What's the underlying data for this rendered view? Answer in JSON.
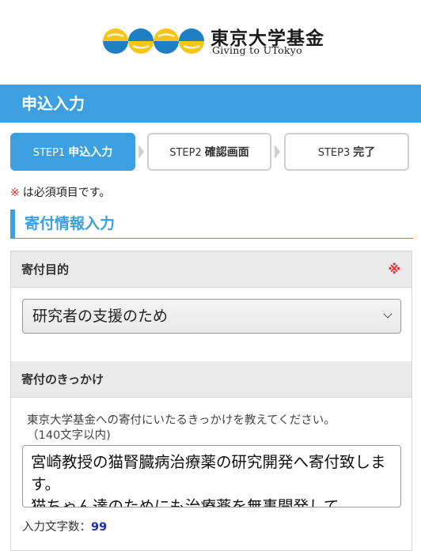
{
  "logo": {
    "title_jp": "東京大学基金",
    "title_en": "Giving to UTokyo"
  },
  "page_title": "申込入力",
  "steps": [
    {
      "no": "STEP1",
      "name": "申込入力",
      "active": true
    },
    {
      "no": "STEP2",
      "name": "確認画面",
      "active": false
    },
    {
      "no": "STEP3",
      "name": "完了",
      "active": false
    }
  ],
  "required_note": {
    "mark": "※",
    "text": "は必須項目です。"
  },
  "section_title": "寄付情報入力",
  "fields": {
    "purpose": {
      "label": "寄付目的",
      "required_mark": "※",
      "selected": "研究者の支援のため"
    },
    "reason": {
      "label": "寄付のきっかけ",
      "help_line1": "東京大学基金への寄付にいたるきっかけを教えてください。",
      "help_line2": "（140文字以内)",
      "value": "宮崎教授の猫腎臓病治療薬の研究開発へ寄付致します。\n猫ちゃん達のためにも治療薬を無事開発して",
      "count_label": "入力文字数：",
      "count_value": "99"
    }
  },
  "colors": {
    "accent": "#3b9fe0",
    "required": "#e0302b",
    "count": "#1a2db0"
  }
}
